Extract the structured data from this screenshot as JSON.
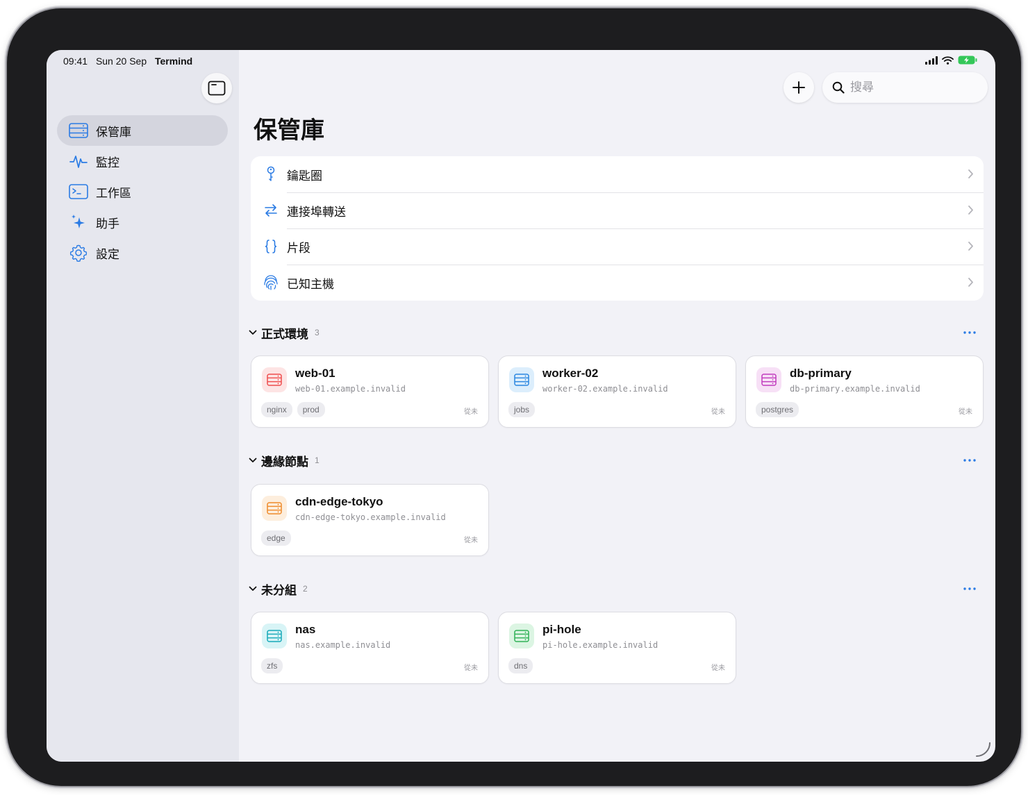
{
  "status": {
    "time": "09:41",
    "date": "Sun 20 Sep",
    "app": "Termind"
  },
  "sidebar": {
    "items": [
      {
        "label": "保管庫",
        "icon": "server-rack-icon",
        "active": true
      },
      {
        "label": "監控",
        "icon": "waveform-icon",
        "active": false
      },
      {
        "label": "工作區",
        "icon": "terminal-icon",
        "active": false
      },
      {
        "label": "助手",
        "icon": "sparkles-icon",
        "active": false
      },
      {
        "label": "設定",
        "icon": "gear-icon",
        "active": false
      }
    ]
  },
  "header": {
    "search_placeholder": "搜尋",
    "title": "保管庫"
  },
  "menu": [
    {
      "label": "鑰匙圈",
      "icon": "key-icon"
    },
    {
      "label": "連接埠轉送",
      "icon": "arrows-swap-icon"
    },
    {
      "label": "片段",
      "icon": "braces-icon"
    },
    {
      "label": "已知主機",
      "icon": "fingerprint-icon"
    }
  ],
  "groups": [
    {
      "name": "正式環境",
      "count": "3",
      "hosts": [
        {
          "name": "web-01",
          "host": "web-01.example.invalid",
          "tags": [
            "nginx",
            "prod"
          ],
          "last": "從未",
          "color": "#ef4d4d",
          "bg": "#fde4e4"
        },
        {
          "name": "worker-02",
          "host": "worker-02.example.invalid",
          "tags": [
            "jobs"
          ],
          "last": "從未",
          "color": "#2a86e0",
          "bg": "#dceefc"
        },
        {
          "name": "db-primary",
          "host": "db-primary.example.invalid",
          "tags": [
            "postgres"
          ],
          "last": "從未",
          "color": "#c13bbd",
          "bg": "#f7e0f6"
        }
      ]
    },
    {
      "name": "邊緣節點",
      "count": "1",
      "hosts": [
        {
          "name": "cdn-edge-tokyo",
          "host": "cdn-edge-tokyo.example.invalid",
          "tags": [
            "edge"
          ],
          "last": "從未",
          "color": "#ef8a2a",
          "bg": "#fdeedd"
        }
      ]
    },
    {
      "name": "未分組",
      "count": "2",
      "hosts": [
        {
          "name": "nas",
          "host": "nas.example.invalid",
          "tags": [
            "zfs"
          ],
          "last": "從未",
          "color": "#16a9b8",
          "bg": "#d8f4f6"
        },
        {
          "name": "pi-hole",
          "host": "pi-hole.example.invalid",
          "tags": [
            "dns"
          ],
          "last": "從未",
          "color": "#2fb156",
          "bg": "#dcf5e3"
        }
      ]
    }
  ],
  "colors": {
    "accent": "#2a7be4",
    "battery": "#34c759"
  }
}
